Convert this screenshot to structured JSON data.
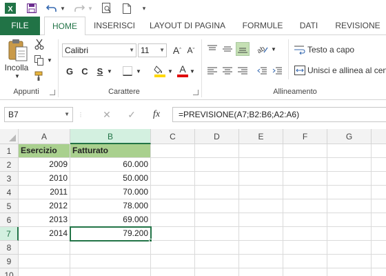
{
  "qat": {
    "icons": [
      "excel-logo",
      "save",
      "undo",
      "redo",
      "print-preview",
      "new-document",
      "customize"
    ]
  },
  "tabs": {
    "file": "FILE",
    "items": [
      "HOME",
      "INSERISCI",
      "LAYOUT DI PAGINA",
      "FORMULE",
      "DATI",
      "REVISIONE"
    ],
    "active": "HOME"
  },
  "ribbon": {
    "clipboard": {
      "paste_label": "Incolla",
      "group_label": "Appunti"
    },
    "font": {
      "font_name": "Calibri",
      "font_size": "11",
      "grow_label": "A",
      "shrink_label": "A",
      "bold_label": "G",
      "italic_label": "C",
      "underline_label": "S",
      "font_color_label": "A",
      "group_label": "Carattere"
    },
    "alignment": {
      "wrap_text_label": "Testo a capo",
      "merge_label": "Unisci e allinea al centro",
      "group_label": "Allineamento"
    }
  },
  "formula_bar": {
    "name_box": "B7",
    "cancel": "✕",
    "enter": "✓",
    "fx": "fx",
    "formula": "=PREVISIONE(A7;B2:B6;A2:A6)"
  },
  "sheet": {
    "columns": [
      "A",
      "B",
      "C",
      "D",
      "E",
      "F",
      "G"
    ],
    "rows": [
      "1",
      "2",
      "3",
      "4",
      "5",
      "6",
      "7",
      "8",
      "9",
      "10"
    ],
    "selected_column": "B",
    "selected_row": "7",
    "header_row": [
      "Esercizio",
      "Fatturato"
    ],
    "data": [
      [
        "2009",
        "60.000"
      ],
      [
        "2010",
        "50.000"
      ],
      [
        "2011",
        "70.000"
      ],
      [
        "2012",
        "78.000"
      ],
      [
        "2013",
        "69.000"
      ],
      [
        "2014",
        "79.200"
      ]
    ]
  },
  "colors": {
    "accent": "#217346",
    "header_fill": "#a9d08e"
  }
}
